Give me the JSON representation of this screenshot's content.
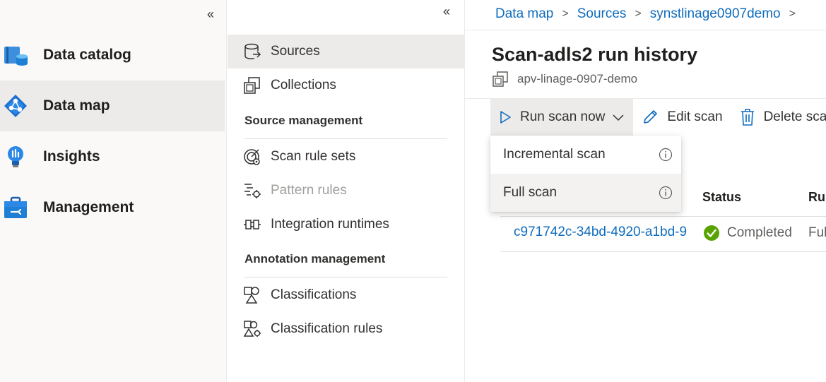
{
  "left_nav": {
    "collapse_glyph": "«",
    "items": [
      {
        "label": "Data catalog",
        "icon": "data-catalog-icon"
      },
      {
        "label": "Data map",
        "icon": "data-map-icon",
        "selected": true
      },
      {
        "label": "Insights",
        "icon": "insights-icon"
      },
      {
        "label": "Management",
        "icon": "management-icon"
      }
    ]
  },
  "sub_nav": {
    "collapse_glyph": "«",
    "items_top": [
      {
        "label": "Sources",
        "icon": "sources-icon",
        "selected": true
      },
      {
        "label": "Collections",
        "icon": "collections-icon"
      }
    ],
    "source_management": {
      "heading": "Source management",
      "items": [
        {
          "label": "Scan rule sets",
          "icon": "scan-rule-sets-icon"
        },
        {
          "label": "Pattern rules",
          "icon": "pattern-rules-icon",
          "disabled": true
        },
        {
          "label": "Integration runtimes",
          "icon": "integration-runtimes-icon"
        }
      ]
    },
    "annotation_management": {
      "heading": "Annotation management",
      "items": [
        {
          "label": "Classifications",
          "icon": "classifications-icon"
        },
        {
          "label": "Classification rules",
          "icon": "classification-rules-icon"
        }
      ]
    }
  },
  "breadcrumb": {
    "items": [
      "Data map",
      "Sources",
      "synstlinage0907demo"
    ],
    "separator": ">"
  },
  "page": {
    "title": "Scan-adls2 run history",
    "subtitle": "apv-linage-0907-demo"
  },
  "toolbar": {
    "run_scan_label": "Run scan now",
    "edit_scan_label": "Edit scan",
    "delete_scan_label": "Delete sca"
  },
  "run_scan_menu": {
    "items": [
      {
        "label": "Incremental scan",
        "info_icon": "info-icon"
      },
      {
        "label": "Full scan",
        "info_icon": "info-icon",
        "hovered": true
      }
    ]
  },
  "table": {
    "columns": [
      "Status",
      "Ru"
    ],
    "rows": [
      {
        "run_id": "c971742c-34bd-4920-a1bd-9",
        "status": "Completed",
        "run_type": "Ful"
      }
    ]
  },
  "colors": {
    "accent": "#0f6cbd",
    "success": "#57a300",
    "selected_bg": "#edebe9"
  }
}
